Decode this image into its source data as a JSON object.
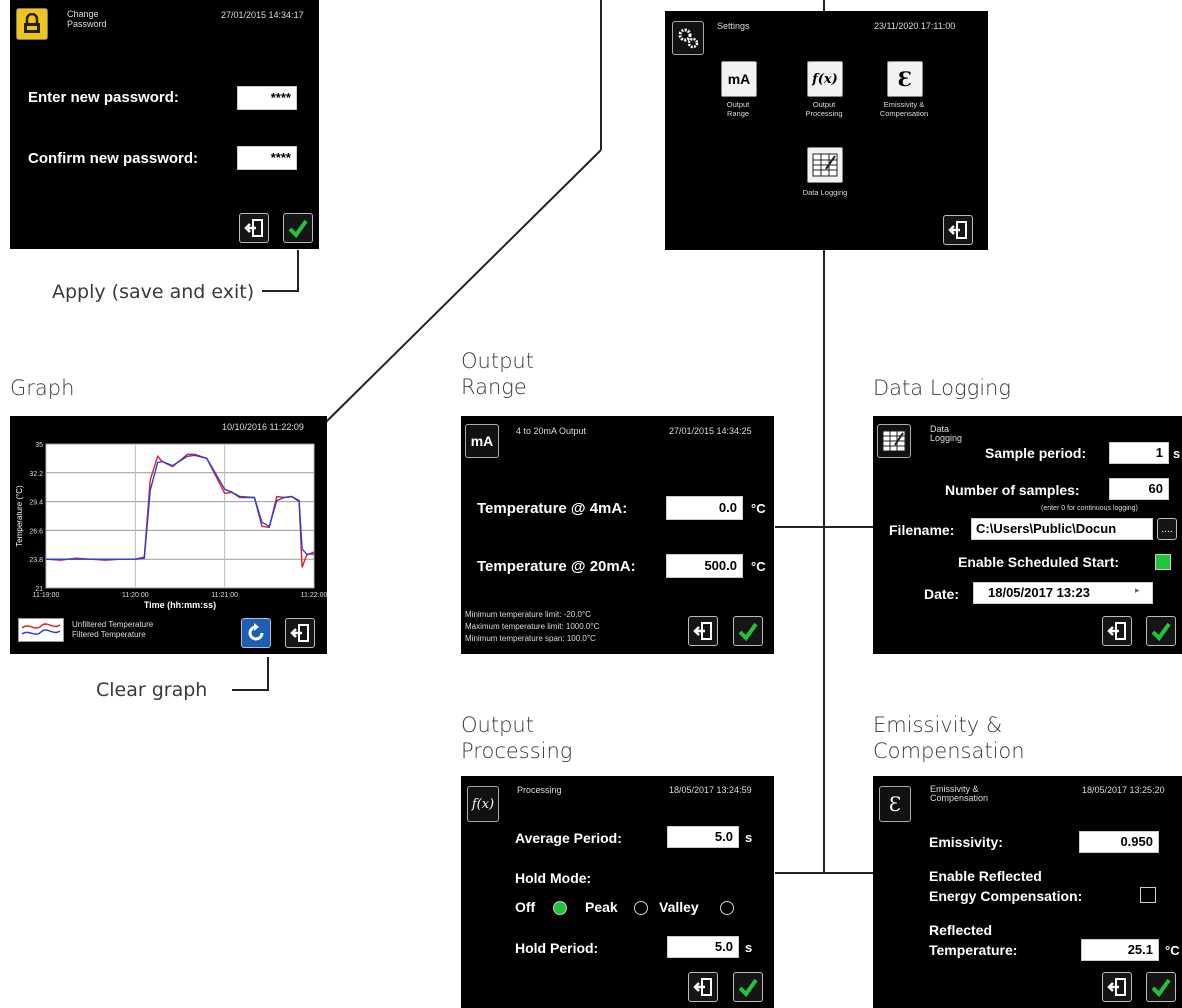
{
  "colors": {
    "accent_green": "#22c33a",
    "refresh_blue": "#1a5fb4",
    "line_dark": "#222222",
    "screen_bg": "#000000"
  },
  "captions": {
    "apply": "Apply (save and exit)",
    "graph": "Graph",
    "clear_graph": "Clear graph",
    "output_range": [
      "Output",
      "Range"
    ],
    "data_logging": "Data Logging",
    "output_processing": [
      "Output",
      "Processing"
    ],
    "emissivity": [
      "Emissivity &",
      "Compensation"
    ]
  },
  "password": {
    "title": [
      "Change",
      "Password"
    ],
    "timestamp": "27/01/2015 14:34:17",
    "new_label": "Enter new password:",
    "new_value": "****",
    "confirm_label": "Confirm new password:",
    "confirm_value": "****",
    "icon": "lock-icon"
  },
  "settings": {
    "title": "Settings",
    "timestamp": "23/11/2020 17:11:00",
    "icon": "gear-icon",
    "tiles": [
      {
        "glyph": "mA",
        "label": [
          "Output",
          "Range"
        ]
      },
      {
        "glyph": "f(x)",
        "label": [
          "Output",
          "Processing"
        ]
      },
      {
        "glyph": "Ɛ",
        "label": [
          "Emissivity &",
          "Compensation"
        ]
      },
      {
        "glyph": "",
        "label": [
          "Data Logging"
        ]
      }
    ]
  },
  "graph": {
    "timestamp": "10/10/2016 11:22:09",
    "ylabel": "Temperature (°C)",
    "xlabel": "Time (hh:mm:ss)",
    "legend": [
      "Unfiltered Temperature",
      "Filtered Temperature"
    ]
  },
  "chart_data": {
    "type": "line",
    "ylim": [
      21,
      35
    ],
    "yticks": [
      "35",
      "32.2",
      "29.4",
      "26.6",
      "23.8",
      "21"
    ],
    "xticks": [
      "11:19:00",
      "11:20:00",
      "11:21:00",
      "11:22:00"
    ],
    "x": [
      0,
      10,
      20,
      30,
      40,
      50,
      60,
      66,
      70,
      75,
      78,
      85,
      95,
      100,
      108,
      120,
      125,
      130,
      140,
      145,
      150,
      155,
      160,
      165,
      170,
      172,
      175,
      180
    ],
    "series": [
      {
        "name": "Unfiltered Temperature",
        "color": "#e02020",
        "values": [
          23.8,
          23.7,
          23.9,
          23.8,
          23.7,
          23.8,
          23.8,
          24.0,
          31.5,
          33.8,
          33.3,
          32.8,
          34.0,
          34.0,
          33.6,
          30.2,
          30.3,
          29.8,
          29.8,
          27.0,
          26.9,
          29.9,
          29.8,
          29.9,
          29.4,
          23.0,
          24.2,
          24.5
        ]
      },
      {
        "name": "Filtered Temperature",
        "color": "#2a3fd8",
        "values": [
          23.8,
          23.8,
          23.8,
          23.8,
          23.8,
          23.8,
          23.8,
          23.9,
          30.5,
          33.2,
          33.3,
          32.9,
          33.8,
          33.9,
          33.6,
          30.6,
          30.3,
          29.9,
          29.8,
          27.4,
          27.0,
          29.5,
          29.8,
          29.9,
          29.5,
          24.8,
          24.3,
          24.3
        ]
      }
    ]
  },
  "output_range": {
    "title": "4 to 20mA Output",
    "timestamp": "27/01/2015 14:34:25",
    "glyph": "mA",
    "t4_label": "Temperature @ 4mA:",
    "t4_value": "0.0",
    "t20_label": "Temperature @ 20mA:",
    "t20_value": "500.0",
    "unit": "°C",
    "notes": [
      "Minimum temperature limit: -20.0°C",
      "Maximum temperature limit: 1000.0°C",
      "Minimum temperature span: 100.0°C"
    ]
  },
  "data_logging": {
    "title": [
      "Data",
      "Logging"
    ],
    "sample_label": "Sample period:",
    "sample_value": "1",
    "sample_unit": "s",
    "num_label": "Number of samples:",
    "num_value": "60",
    "num_hint": "(enter 0 for continuous logging)",
    "filename_label": "Filename:",
    "filename_value": "C:\\Users\\Public\\Docun",
    "browse": "....",
    "sched_label": "Enable Scheduled Start:",
    "date_label": "Date:",
    "date_value": "18/05/2017   13:23",
    "date_arrow": "▸"
  },
  "processing": {
    "title": "Processing",
    "timestamp": "18/05/2017 13:24:59",
    "glyph": "f(x)",
    "avg_label": "Average Period:",
    "avg_value": "5.0",
    "avg_unit": "s",
    "hold_mode_label": "Hold Mode:",
    "off": "Off",
    "peak": "Peak",
    "valley": "Valley",
    "hold_period_label": "Hold Period:",
    "hold_period_value": "5.0",
    "hold_period_unit": "s"
  },
  "emissivity": {
    "title": [
      "Emissivity &",
      "Compensation"
    ],
    "timestamp": "18/05/2017 13:25:20",
    "glyph": "Ɛ",
    "emis_label": "Emissivity:",
    "emis_value": "0.950",
    "refl_label": [
      "Enable Reflected",
      "Energy Compensation:"
    ],
    "rtemp_label": [
      "Reflected",
      "Temperature:"
    ],
    "rtemp_value": "25.1",
    "rtemp_unit": "°C"
  }
}
